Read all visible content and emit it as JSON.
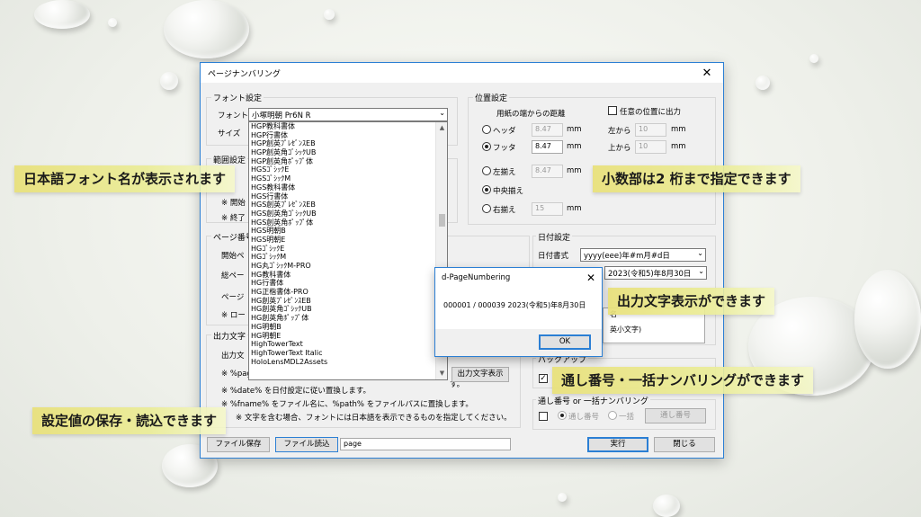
{
  "window": {
    "title": "ページナンバリング"
  },
  "font_group": {
    "title": "フォント設定",
    "font_label": "フォント",
    "font_value": "小塚明朝 Pr6N R",
    "size_label": "サイズ",
    "font_list": [
      "HGP教科書体",
      "HGP行書体",
      "HGP創英ﾌﾟﾚｾﾞﾝｽEB",
      "HGP創英角ｺﾞｼｯｸUB",
      "HGP創英角ﾎﾟｯﾌﾟ体",
      "HGSｺﾞｼｯｸE",
      "HGSｺﾞｼｯｸM",
      "HGS教科書体",
      "HGS行書体",
      "HGS創英ﾌﾟﾚｾﾞﾝｽEB",
      "HGS創英角ｺﾞｼｯｸUB",
      "HGS創英角ﾎﾟｯﾌﾟ体",
      "HGS明朝B",
      "HGS明朝E",
      "HGｺﾞｼｯｸE",
      "HGｺﾞｼｯｸM",
      "HG丸ｺﾞｼｯｸM-PRO",
      "HG教科書体",
      "HG行書体",
      "HG正楷書体-PRO",
      "HG創英ﾌﾟﾚｾﾞﾝｽEB",
      "HG創英角ｺﾞｼｯｸUB",
      "HG創英角ﾎﾟｯﾌﾟ体",
      "HG明朝B",
      "HG明朝E",
      "HighTowerText",
      "HighTowerText Italic",
      "HoloLensMDL2Assets"
    ]
  },
  "range_group": {
    "title": "範囲設定",
    "start_prefix": "※ 開始",
    "end_prefix": "※ 終了"
  },
  "page_group": {
    "title": "ページ番号",
    "start_label": "開始ペ",
    "total_label": "総ペー",
    "page_label": "ページ",
    "note_prefix": "※ ロー"
  },
  "output_group": {
    "title": "出力文字",
    "out_label": "出力文",
    "note_page": "※ %page",
    "note_date": "※ %date% を日付設定に従い置換します。",
    "note_fname": "※ %fname% をファイル名に、%path% をファイルパスに置換します。",
    "note_font": "※ 文字を含む場合、フォントには日本語を表示できるものを指定してください。",
    "note_suffix": "す。",
    "preview_button": "出力文字表示"
  },
  "position_group": {
    "title": "位置設定",
    "distance_label": "用紙の端からの距離",
    "arbitrary_label": "任意の位置に出力",
    "header_label": "ヘッダ",
    "header_value": "8.47",
    "footer_label": "フッタ",
    "footer_value": "8.47",
    "left_from_label": "左から",
    "left_from_value": "10",
    "top_from_label": "上から",
    "top_from_value": "10",
    "unit": "mm",
    "align_left_label": "左揃え",
    "align_left_value": "8.47",
    "align_center_label": "中央揃え",
    "align_right_label": "右揃え",
    "align_right_value": "15"
  },
  "date_group": {
    "title": "日付設定",
    "format_label": "日付書式",
    "format_value": "yyyy(eee)年#m月#d日",
    "date_value": "2023(令和5)年8月30日",
    "name_fragment": "名",
    "option_fragment": "英小文字)"
  },
  "backup_group": {
    "title": "バックアップ"
  },
  "batch_group": {
    "title": "通し番号 or 一括ナンバリング",
    "serial_label": "通し番号",
    "batch_label": "一括",
    "serial_button": "通し番号"
  },
  "footer": {
    "save_button": "ファイル保存",
    "load_button": "ファイル読込",
    "filename_value": "page",
    "run_button": "実行",
    "close_button": "閉じる"
  },
  "message_box": {
    "title": "d-PageNumbering",
    "message": "000001 / 000039 2023(令和5)年8月30日",
    "ok_button": "OK"
  },
  "callouts": {
    "fonts": "日本語フォント名が表示されます",
    "decimals": "小数部は2 桁まで指定できます",
    "output": "出力文字表示ができます",
    "serial": "通し番号・一括ナンバリングができます",
    "save": "設定値の保存・読込できます"
  }
}
